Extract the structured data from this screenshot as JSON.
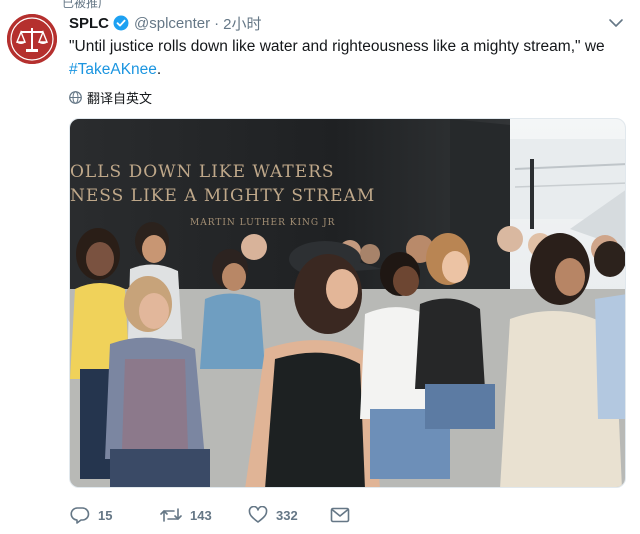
{
  "top_strip": {
    "text": "已被推广"
  },
  "tweet": {
    "name": "SPLC",
    "handle": "@splcenter",
    "separator": "·",
    "time": "2小时",
    "text_main": "\"Until justice rolls down like water and righteousness like a mighty stream,\" we",
    "hashtag": "#TakeAKnee",
    "text_end": ".",
    "translate_label": "翻译自英文"
  },
  "photo": {
    "wall_line1": "OLLS DOWN LIKE WATERS",
    "wall_line2": "NESS LIKE A MIGHTY STREAM",
    "wall_attribution": "MARTIN LUTHER KING JR"
  },
  "actions": {
    "replies": "15",
    "retweets": "143",
    "likes": "332"
  },
  "colors": {
    "brand_red": "#b5302e",
    "link_blue": "#1b95e0",
    "muted": "#657786"
  }
}
